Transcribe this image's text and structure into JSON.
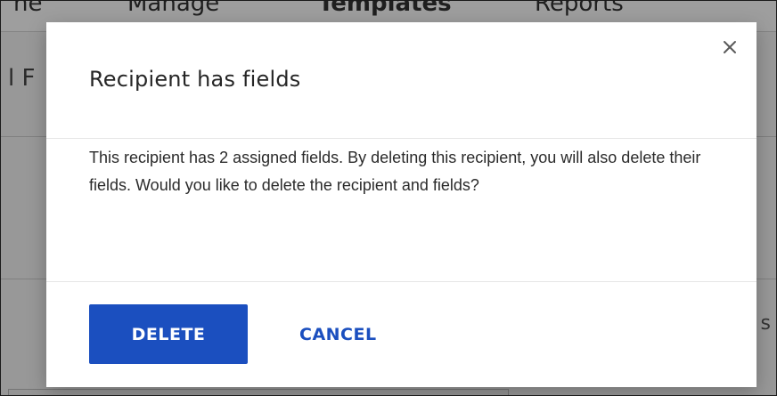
{
  "background": {
    "tabs": [
      "ne",
      "Manage",
      "Templates",
      "Reports"
    ],
    "title_fragment": "l F",
    "right_fragment": "s"
  },
  "dialog": {
    "title": "Recipient has fields",
    "message": "This recipient has 2 assigned fields. By deleting this recipient, you will also delete their fields. Would you like to delete the recipient and fields?",
    "close_icon": "close-icon",
    "delete_label": "DELETE",
    "cancel_label": "CANCEL"
  },
  "colors": {
    "primary": "#1b4fbf",
    "overlay": "rgba(0,0,0,0.38)"
  }
}
